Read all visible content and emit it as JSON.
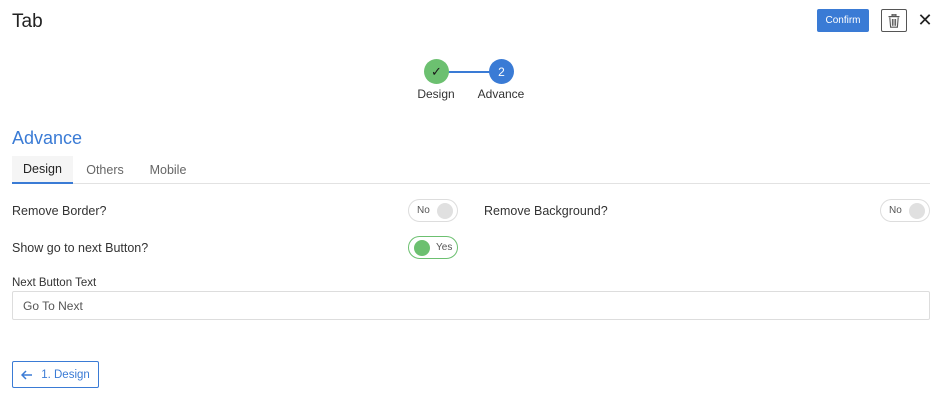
{
  "header": {
    "title": "Tab",
    "confirm_label": "Confirm",
    "trash_icon": "trash-icon",
    "close_glyph": "✕"
  },
  "stepper": {
    "steps": [
      {
        "label": "Design",
        "marker": "✓",
        "status": "complete"
      },
      {
        "label": "Advance",
        "marker": "2",
        "status": "current"
      }
    ]
  },
  "section_title": "Advance",
  "tabs": [
    {
      "label": "Design",
      "active": true
    },
    {
      "label": "Others",
      "active": false
    },
    {
      "label": "Mobile",
      "active": false
    }
  ],
  "fields": {
    "remove_border": {
      "label": "Remove Border?",
      "value": "No"
    },
    "remove_background": {
      "label": "Remove Background?",
      "value": "No"
    },
    "show_next_button": {
      "label": "Show go to next Button?",
      "value": "Yes"
    },
    "next_button_text": {
      "label": "Next Button Text",
      "value": "Go To Next"
    }
  },
  "back_button": {
    "label": "1. Design",
    "icon": "arrow-left-icon"
  },
  "colors": {
    "accent": "#3a7bd5",
    "success": "#6cc070"
  }
}
